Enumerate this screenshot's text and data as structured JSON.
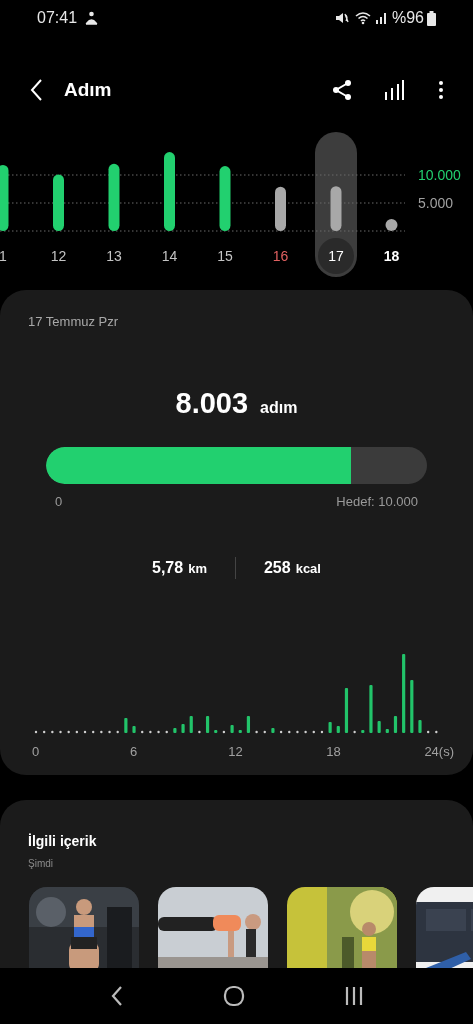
{
  "status_bar": {
    "time": "07:41",
    "battery": "%96"
  },
  "header": {
    "title": "Adım"
  },
  "day_chart": {
    "chart_data": {
      "type": "bar",
      "categories": [
        "1",
        "12",
        "13",
        "14",
        "15",
        "16",
        "17",
        "18"
      ],
      "series": [
        {
          "color": "#22d06f",
          "values": [
            11800,
            10100,
            12000,
            14100,
            11600,
            null,
            null,
            null
          ]
        },
        {
          "color": "#a8a8a8",
          "values": [
            null,
            null,
            null,
            null,
            null,
            7900,
            8000,
            null
          ]
        }
      ],
      "ylim": [
        0,
        14500
      ],
      "yticks": [
        {
          "value": 5000,
          "label": "5.000"
        },
        {
          "value": 10000,
          "label": "10.000"
        }
      ]
    },
    "days": [
      {
        "kind": "weekday",
        "selected": false
      },
      {
        "kind": "weekday",
        "selected": false
      },
      {
        "kind": "weekday",
        "selected": false
      },
      {
        "kind": "weekday",
        "selected": false
      },
      {
        "kind": "weekday",
        "selected": false
      },
      {
        "kind": "holiday",
        "selected": false
      },
      {
        "kind": "weekday",
        "selected": true
      },
      {
        "kind": "today",
        "selected": false
      }
    ]
  },
  "summary": {
    "date": "17 Temmuz Pzr",
    "steps": "8.003",
    "unit": "adım",
    "progress": {
      "level": 0.8003,
      "start": "0",
      "goal": "Hedef: 10.000"
    },
    "stats": [
      {
        "value": "5,78",
        "unit": "km"
      },
      {
        "value": "258",
        "unit": "kcal"
      }
    ],
    "hourly_axis_labels": [
      "0",
      "6",
      "12",
      "18",
      "24(s)"
    ]
  },
  "related": {
    "title": "İlgili içerik",
    "subtitle": "Şimdi"
  }
}
